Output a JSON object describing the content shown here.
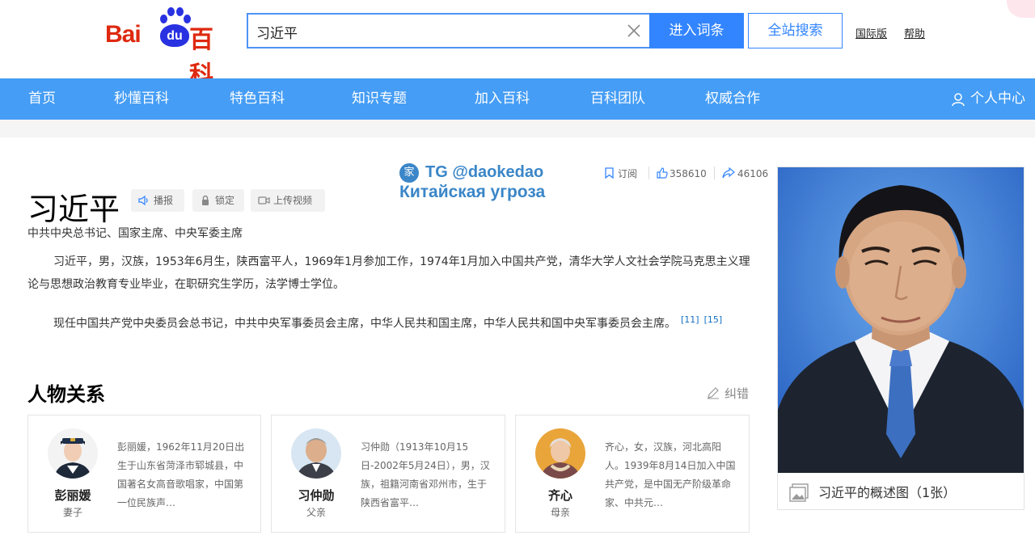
{
  "header": {
    "logo": {
      "left": "Bai",
      "mid": "du",
      "right": "百科"
    },
    "search_value": "习近平",
    "enter_label": "进入词条",
    "site_search_label": "全站搜索",
    "links": [
      "国际版",
      "帮助"
    ]
  },
  "nav": {
    "items": [
      "首页",
      "秒懂百科",
      "特色百科",
      "知识专题",
      "加入百科",
      "百科团队",
      "权威合作"
    ],
    "user_label": "个人中心"
  },
  "entry": {
    "title": "习近平",
    "actions": [
      "播报",
      "锁定",
      "上传视频"
    ],
    "stats": {
      "subscribe": "订阅",
      "likes": "358610",
      "shares": "46106"
    },
    "subtitle": "中共中央总书记、国家主席、中央军委主席",
    "para1": "习近平，男，汉族，1953年6月生，陕西富平人，1969年1月参加工作，1974年1月加入中国共产党，清华大学人文社会学院马克思主义理论与思想政治教育专业毕业，在职研究生学历，法学博士学位。",
    "para2": "现任中国共产党中央委员会总书记，中共中央军事委员会主席，中华人民共和国主席，中华人民共和国中央军事委员会主席。",
    "refs": [
      "[11]",
      "[15]"
    ]
  },
  "watermark": {
    "line1": "TG @daokedao",
    "line2": "Китайская угроза",
    "icon": "家"
  },
  "relations": {
    "title": "人物关系",
    "edit_label": "纠错",
    "cards": [
      {
        "name": "彭丽媛",
        "role": "妻子",
        "desc": "彭丽媛，1962年11月20日出生于山东省菏泽市郓城县，中国著名女高音歌唱家，中国第一位民族声…"
      },
      {
        "name": "习仲勋",
        "role": "父亲",
        "desc": "习仲勋（1913年10月15日-2002年5月24日），男，汉族，祖籍河南省邓州市，生于陕西省富平…"
      },
      {
        "name": "齐心",
        "role": "母亲",
        "desc": "齐心，女，汉族，河北高阳人。1939年8月14日加入中国共产党，是中国无产阶级革命家、中共元…"
      }
    ]
  },
  "photo": {
    "caption": "习近平的概述图（1张）"
  },
  "colors": {
    "brand_red": "#de2910",
    "brand_blue": "#2932e1",
    "nav_blue": "#459df5",
    "button_blue": "#3385ff",
    "link_blue": "#136ec2"
  }
}
